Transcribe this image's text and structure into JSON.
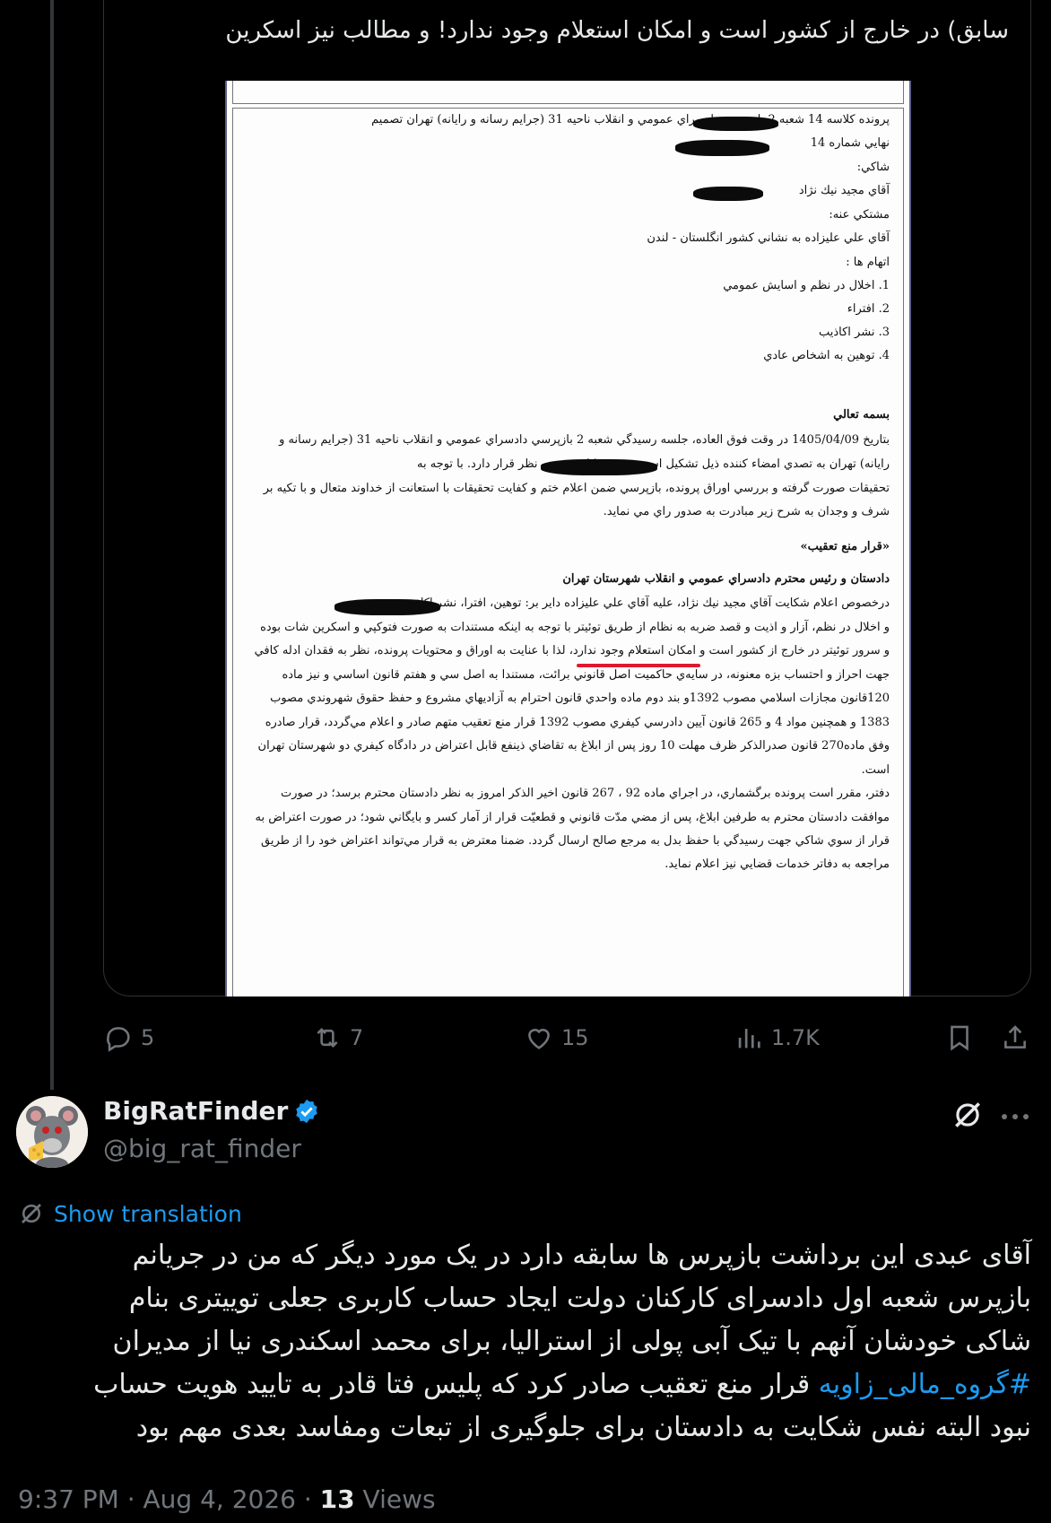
{
  "quoted": {
    "text": "سابق) در خارج از کشور است و امکان استعلام وجود ندارد! و مطالب نیز اسکرین",
    "document": {
      "lines": [
        "پرونده کلاسه 14 شعبه 2 بازپرسي دادسراي عمومي و انقلاب ناحيه 31 (جرايم رسانه و رايانه) تهران تصميم",
        "نهايي شماره 14",
        "شاكي:",
        "آقاي مجيد نيك نژاد",
        "مشتكي عنه:",
        "آقاي علي عليزاده به نشاني كشور انگلستان - لندن",
        "اتهام ها :",
        "1. اخلال در نظم و اسايش عمومي",
        "2. افتراء",
        "3. نشر اكاذيب",
        "4. توهين به اشخاص عادي",
        "بسمه تعالي",
        "بتاريخ 1405/04/09 در وقت فوق العاده، جلسه رسيدگي شعبه 2 بازپرسي دادسراي عمومي و انقلاب ناحيه 31 (جرايم رسانه و",
        "رايانه) تهران به تصدي امضاء كننده ذيل تشكيل است، پرونده كلاسه تحت نظر قرار دارد. با توجه به",
        "تحقيقات صورت گرفته و بررسي اوراق پرونده، بازپرسي ضمن اعلام ختم و كفايت تحقيقات با استعانت از خداوند متعال و با تكيه بر",
        "شرف و وجدان به شرح زير مبادرت به صدور راي مي نمايد.",
        "«قرار منع تعقيب»",
        "دادستان و رئيس محترم دادسراي عمومي و انقلاب شهرستان تهران",
        "درخصوص اعلام شكايت آقاي مجيد نيك نژاد، عليه آقاي علي عليزاده داير بر: توهين، افترا، نشر اكاذيب",
        "و اخلال در نظم، آزار و اذيت و قصد ضربه به نظام از طريق توئيتر با توجه به اينكه مستندات به صورت فتوكپي و اسكرين شات بوده",
        "و سرور توئيتر در خارج از كشور است و امكان استعلام وجود ندارد، لذا با عنايت به اوراق و محتويات پرونده، نظر به فقدان ادله كافي",
        "جهت احراز و احتساب بزه معنونه، در سايه‌ي حاكميت اصل قانوني برائت، مستندا به اصل سي و هفتم قانون اساسي و نيز ماده",
        "120قانون مجازات اسلامي مصوب 1392و بند دوم ماده واحدي قانون احترام به آزاديهاي مشروع و حفظ حقوق شهروندي مصوب",
        "1383 و همچنين مواد 4 و 265 قانون آيين دادرسي كيفري مصوب 1392 قرار منع تعقيب متهم صادر و اعلام مي‌گردد، قرار صادره",
        "وفق ماده270 قانون صدرالذكر ظرف مهلت 10 روز پس از ابلاغ به تقاضاي ذينفع قابل اعتراض در دادگاه كيفري دو شهرستان تهران",
        "است.",
        "دفتر، مقرر است پرونده برگشماري، در اجراي ماده 92 ، 267 قانون اخير الذكر امروز به نظر دادستان محترم برسد؛ در صورت",
        "موافقت دادستان محترم به طرفين ابلاغ، پس از مضي مدّت قانوني و قطعيّت قرار از آمار كسر و بايگاني شود؛ در صورت اعتراض به",
        "قرار از سوي شاكي جهت رسيدگي با حفظ بدل به مرجع صالح ارسال گردد. ضمنا معترض به قرار مي‌تواند اعتراض خود را از طريق",
        "مراجعه به دفاتر خدمات قضايي نيز اعلام نمايد."
      ]
    }
  },
  "actions": {
    "replies": "5",
    "reposts": "7",
    "likes": "15",
    "views": "1.7K"
  },
  "reply": {
    "display_name": "BigRatFinder",
    "handle": "@big_rat_finder",
    "show_translation": "Show translation",
    "body_lines": [
      "آقای عبدی این برداشت بازپرس ها سابقه دارد در یک مورد دیگر که من در جریانم",
      "بازپرس شعبه اول دادسرای کارکنان دولت ایجاد حساب کاربری جعلی توییتری بنام",
      "شاکی خودشان آنهم با تیک آبی پولی از استرالیا، برای محمد اسکندری نیا از مدیران"
    ],
    "hashtag": "#گروه_مالی_زاویه",
    "body_line4_rest": " قرار منع تعقیب صادر کرد که پلیس فتا قادر به تایید هویت حساب",
    "body_line5": "نبود البته نفس شکایت به دادستان برای جلوگیری از تبعات ومفاسد بعدی مهم بود",
    "timestamp": "9:37 PM · Aug 4, 2026 · ",
    "view_count": "13",
    "views_label": " Views"
  },
  "colors": {
    "background": "#000000",
    "text": "#e7e9ea",
    "muted": "#71767b",
    "accent": "#1d9bf0",
    "verified": "#1d9bf0",
    "highlight_underline": "#e0182d"
  }
}
